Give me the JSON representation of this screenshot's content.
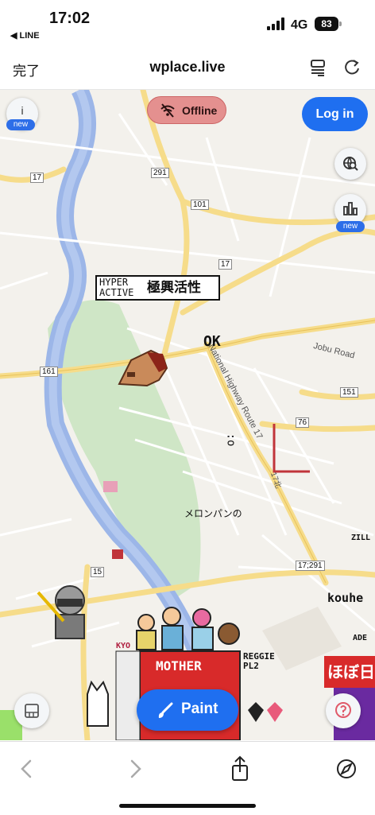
{
  "status_bar": {
    "time": "17:02",
    "back_app": "◀ LINE",
    "network": "4G",
    "battery": "83"
  },
  "browser": {
    "done_label": "完了",
    "url": "wplace.live"
  },
  "map_overlay": {
    "offline_label": "Offline",
    "login_label": "Log in",
    "info_label": "i",
    "info_badge": "new",
    "leaderboard_badge": "new",
    "paint_label": "Paint"
  },
  "map_labels": {
    "route_291": "291",
    "route_17_a": "17",
    "route_101": "101",
    "route_17_b": "17",
    "route_161": "161",
    "route_151": "151",
    "route_76": "76",
    "route_15": "15",
    "route_17_291": "17;291",
    "road_jobu": "Jobu Road",
    "road_national": "National Highway Route 17",
    "road_national_tail": "17北"
  },
  "pixel_art_text": {
    "hyper": "HYPER",
    "active": "ACTIVE",
    "kanji": "極興活性",
    "ok": "OK",
    "melon": "メロンパンの",
    "kouhe": "kouhe",
    "zill": "ZILL",
    "ade": "ADE",
    "reggie": "REGGIE",
    "pl2": "PL2",
    "kyo": "KYO",
    "mother": "MOTHER",
    "hobo": "ほぼ日",
    "colon": ":o"
  },
  "colors": {
    "accent": "#1f6ff0",
    "offline_bg": "#e4908f",
    "river": "#9cb6e8",
    "park": "#cfe6c6",
    "road_major": "#f6dc8a"
  },
  "icons": {
    "offline": "wifi-off-icon",
    "paint": "paintbrush-icon",
    "map_search": "globe-search-icon",
    "leaderboard": "bar-chart-icon"
  }
}
